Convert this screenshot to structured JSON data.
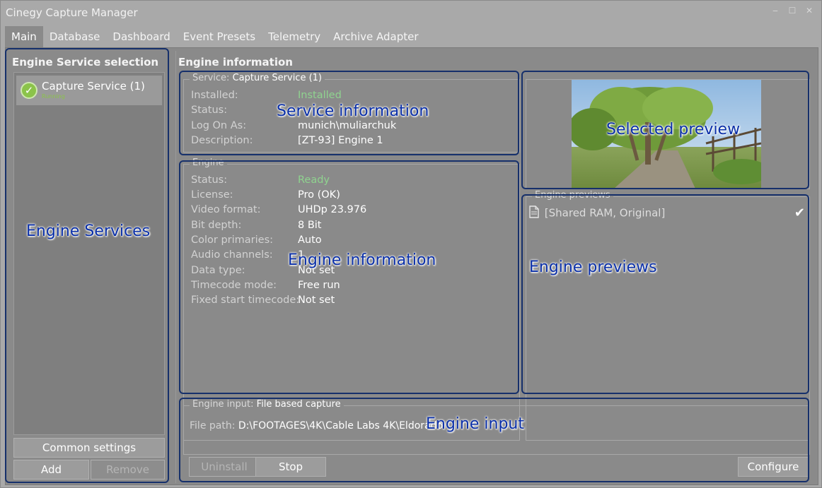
{
  "window": {
    "title": "Cinegy Capture Manager",
    "controls": {
      "minimize": "‒",
      "maximize": "☐",
      "close": "✕"
    }
  },
  "tabs": [
    "Main",
    "Database",
    "Dashboard",
    "Event Presets",
    "Telemetry",
    "Archive Adapter"
  ],
  "left": {
    "title": "Engine Service selection",
    "service": {
      "name": "Capture Service (1)",
      "state": "Running"
    },
    "common_settings": "Common settings",
    "add": "Add",
    "remove": "Remove"
  },
  "engine_info": {
    "title": "Engine information",
    "service_group": {
      "legend_prefix": "Service:",
      "legend_value": "Capture Service (1)",
      "rows": [
        {
          "key": "Installed:",
          "value": "Installed"
        },
        {
          "key": "Status:",
          "value": ""
        },
        {
          "key": "Log On As:",
          "value": "munich\\muliarchuk"
        },
        {
          "key": "Description:",
          "value": "[ZT-93] Engine 1"
        }
      ]
    },
    "engine_group": {
      "legend": "Engine",
      "rows": [
        {
          "key": "Status:",
          "value": "Ready"
        },
        {
          "key": "License:",
          "value": "Pro (OK)"
        },
        {
          "key": "Video format:",
          "value": "UHDp 23.976"
        },
        {
          "key": "Bit depth:",
          "value": "8 Bit"
        },
        {
          "key": "Color primaries:",
          "value": "Auto"
        },
        {
          "key": "Audio channels:",
          "value": "1"
        },
        {
          "key": "Data type:",
          "value": "Not set"
        },
        {
          "key": "Timecode mode:",
          "value": "Free run"
        },
        {
          "key": "Fixed start timecode:",
          "value": "Not set"
        }
      ]
    },
    "previews_group": {
      "legend": "Engine previews",
      "item": "[Shared RAM, Original]",
      "icon": "document-icon"
    },
    "input_group": {
      "legend_prefix": "Engine input:",
      "legend_value": "File based capture",
      "file_path_label": "File path:",
      "file_path_value": "D:\\FOOTAGES\\4K\\Cable Labs 4K\\Eldorado"
    },
    "buttons": {
      "uninstall": "Uninstall",
      "stop": "Stop",
      "configure": "Configure"
    }
  },
  "annotations": {
    "engine_services": "Engine Services",
    "service_information": "Service information",
    "selected_preview": "Selected preview",
    "engine_information": "Engine information",
    "engine_previews": "Engine previews",
    "engine_input": "Engine input"
  },
  "colors": {
    "annotation": "#0a2fa8",
    "success": "#8fd38f",
    "panel": "#8a8a8a"
  }
}
